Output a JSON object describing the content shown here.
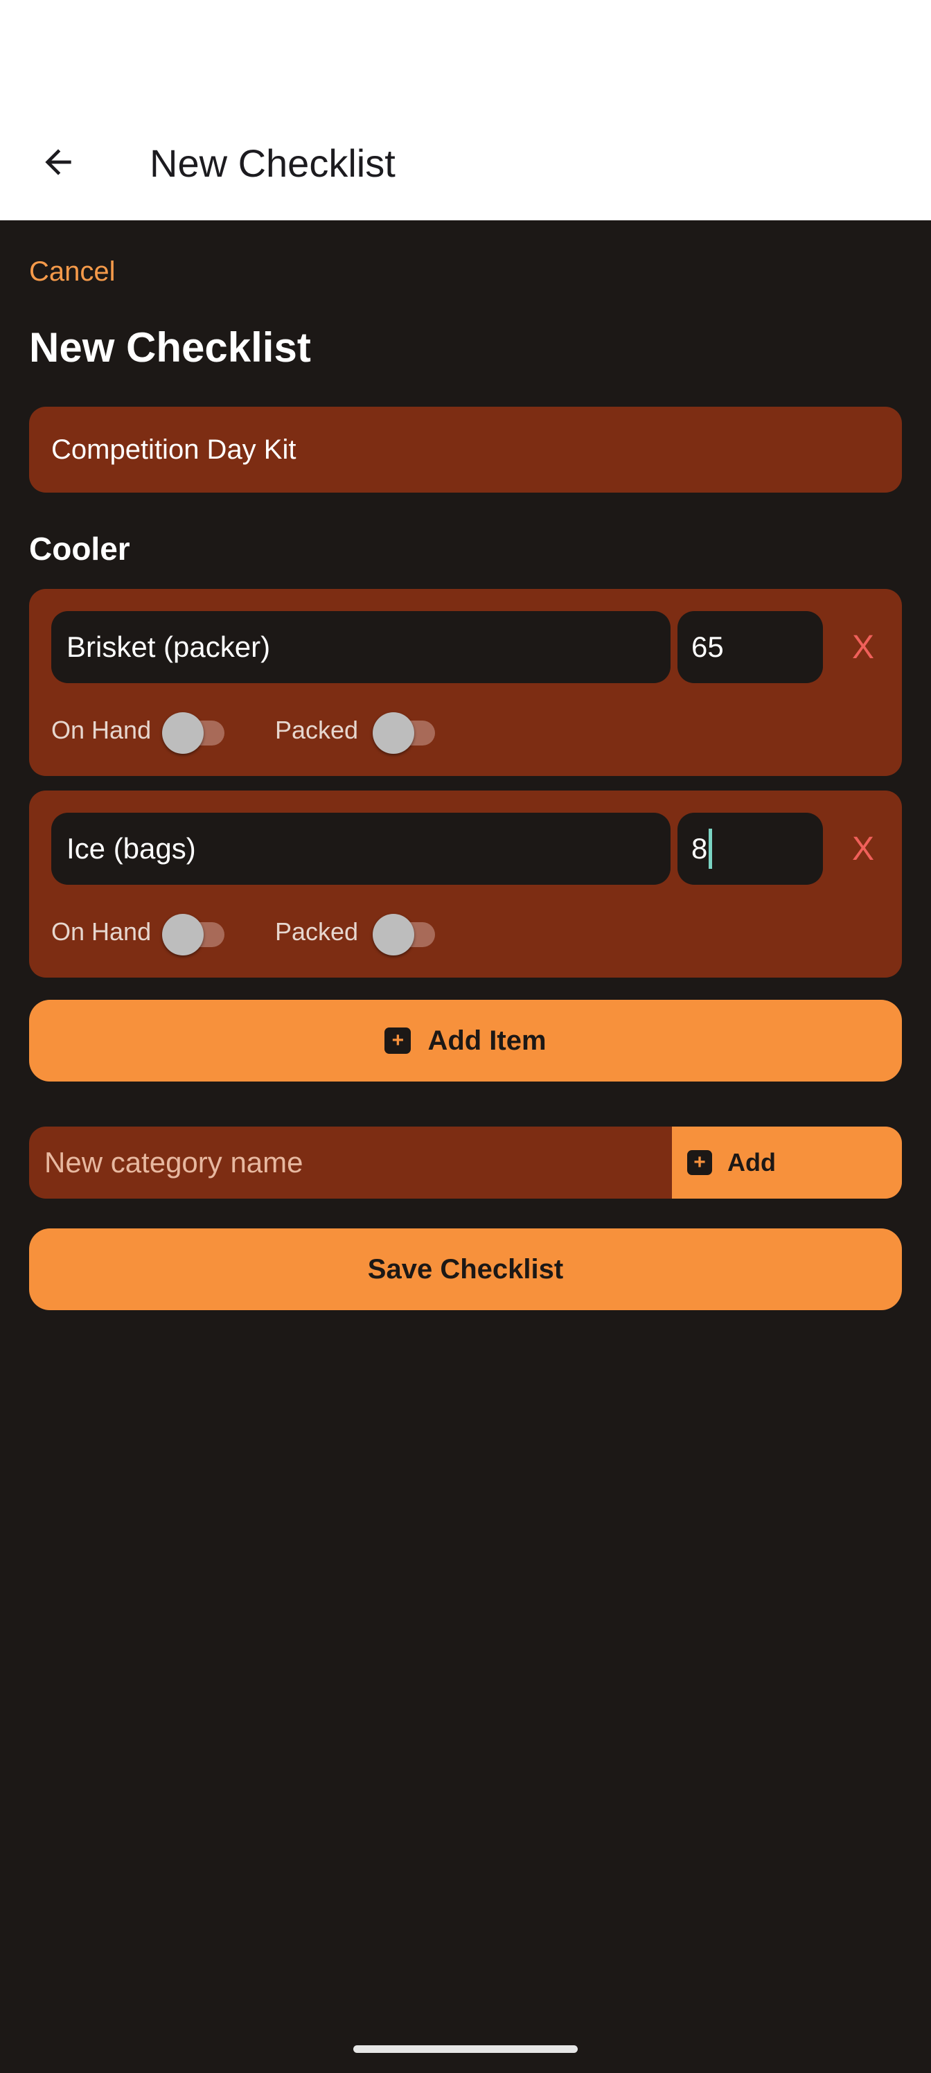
{
  "app_bar": {
    "title": "New Checklist",
    "back_icon": "arrow-left-icon"
  },
  "form": {
    "cancel_label": "Cancel",
    "heading": "New Checklist",
    "checklist_name": "Competition Day Kit"
  },
  "category": {
    "title": "Cooler",
    "items": [
      {
        "name": "Brisket (packer)",
        "quantity": "65",
        "remove_label": "X",
        "on_hand_label": "On Hand",
        "on_hand": false,
        "packed_label": "Packed",
        "packed": false
      },
      {
        "name": "Ice (bags)",
        "quantity": "8",
        "remove_label": "X",
        "on_hand_label": "On Hand",
        "on_hand": false,
        "packed_label": "Packed",
        "packed": false
      }
    ],
    "add_item_label": "Add Item"
  },
  "new_category": {
    "placeholder": "New category name",
    "add_label": "Add"
  },
  "save_label": "Save Checklist",
  "colors": {
    "background": "#1c1816",
    "card": "#7d2d13",
    "accent": "#f7913c",
    "remove": "#f0605a",
    "app_bar": "#ffffff"
  }
}
